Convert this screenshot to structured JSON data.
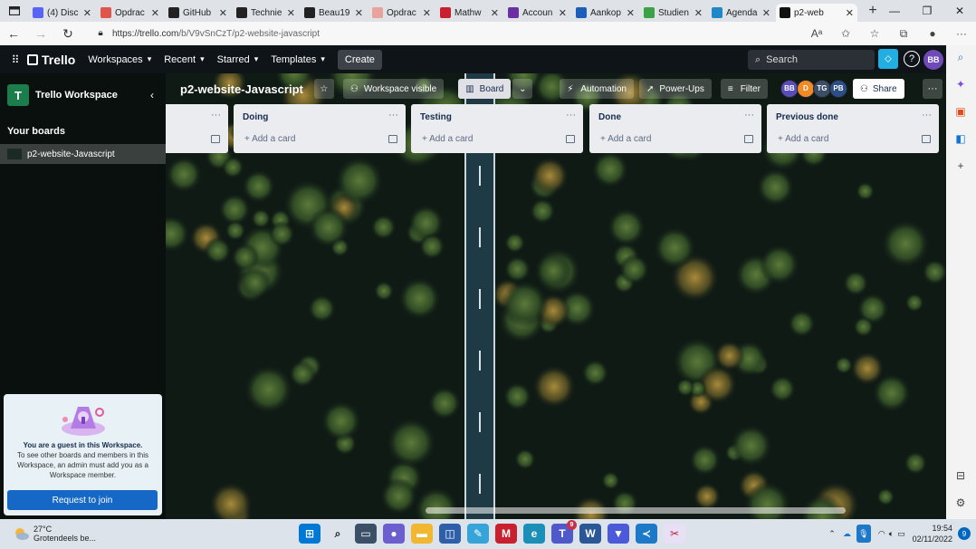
{
  "browser": {
    "tabs": [
      {
        "title": "(4) Disc",
        "icon": "discord-icon",
        "color": "#5865f2"
      },
      {
        "title": "Opdrac",
        "icon": "opdracht-icon",
        "color": "#e0554a"
      },
      {
        "title": "GitHub",
        "icon": "github-icon",
        "color": "#222222"
      },
      {
        "title": "Technie",
        "icon": "github-icon",
        "color": "#222222"
      },
      {
        "title": "Beau19",
        "icon": "github-icon",
        "color": "#222222"
      },
      {
        "title": "Opdrac",
        "icon": "opdracht-icon",
        "color": "#e8a39b"
      },
      {
        "title": "Mathw",
        "icon": "mathway-icon",
        "color": "#c8202e"
      },
      {
        "title": "Accoun",
        "icon": "account-icon",
        "color": "#6b2fa3"
      },
      {
        "title": "Aankop",
        "icon": "aankop-icon",
        "color": "#1c5fb8"
      },
      {
        "title": "Studien",
        "icon": "studie-icon",
        "color": "#3aa346"
      },
      {
        "title": "Agenda",
        "icon": "agenda-icon",
        "color": "#1e88c8"
      },
      {
        "title": "p2-web",
        "icon": "trello-icon",
        "color": "#111111",
        "active": true
      }
    ],
    "url_prefix": "https://trello.com",
    "url_path": "/b/V9vSnCzT/p2-website-javascript"
  },
  "header": {
    "logo": "Trello",
    "nav": [
      {
        "label": "Workspaces"
      },
      {
        "label": "Recent"
      },
      {
        "label": "Starred"
      },
      {
        "label": "Templates"
      }
    ],
    "create": "Create",
    "search_placeholder": "Search",
    "avatar": "BB"
  },
  "sidebar": {
    "workspace_initial": "T",
    "workspace_name": "Trello Workspace",
    "boards_heading": "Your boards",
    "board_name": "p2-website-Javascript",
    "guest_title": "You are a guest in this Workspace.",
    "guest_text": "To see other boards and members in this Workspace, an admin must add you as a Workspace member.",
    "join": "Request to join"
  },
  "board": {
    "title": "p2-website-Javascript",
    "visibility": "Workspace visible",
    "view": "Board",
    "automation": "Automation",
    "powerups": "Power-Ups",
    "filter": "Filter",
    "share": "Share",
    "members": [
      {
        "initials": "BB",
        "color": "#5a4db8"
      },
      {
        "initials": "D",
        "color": "#f08a24"
      },
      {
        "initials": "TG",
        "color": "#3b4e66"
      },
      {
        "initials": "PB",
        "color": "#2d4f86"
      }
    ],
    "lists": [
      {
        "title": "",
        "add": ""
      },
      {
        "title": "Doing",
        "add": "+ Add a card"
      },
      {
        "title": "Testing",
        "add": "+ Add a card"
      },
      {
        "title": "Done",
        "add": "+ Add a card"
      },
      {
        "title": "Previous done",
        "add": "+ Add a card"
      }
    ]
  },
  "taskbar": {
    "temp": "27°C",
    "weather": "Grotendeels be...",
    "teams_badge": "9",
    "time": "19:54",
    "date": "02/11/2022",
    "notifications": "9"
  }
}
